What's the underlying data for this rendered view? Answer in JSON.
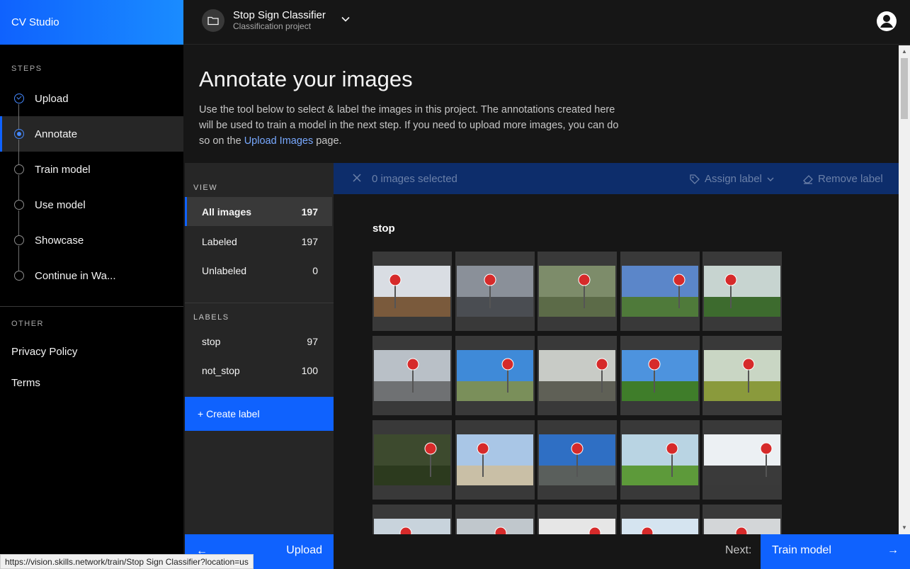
{
  "app": {
    "name": "CV Studio"
  },
  "sidebar": {
    "steps_label": "STEPS",
    "steps": [
      {
        "label": "Upload",
        "state": "done"
      },
      {
        "label": "Annotate",
        "state": "active"
      },
      {
        "label": "Train model",
        "state": "todo"
      },
      {
        "label": "Use model",
        "state": "todo"
      },
      {
        "label": "Showcase",
        "state": "todo"
      },
      {
        "label": "Continue in Wa...",
        "state": "todo"
      }
    ],
    "other_label": "OTHER",
    "other_links": [
      "Privacy Policy",
      "Terms"
    ]
  },
  "header": {
    "project_title": "Stop Sign Classifier",
    "project_subtitle": "Classification project",
    "icons": {
      "project": "folder-icon",
      "toggle": "chevron-down-icon",
      "account": "user-avatar-icon"
    }
  },
  "main": {
    "title": "Annotate your images",
    "description_before": "Use the tool below to select & label the images in this project. The annotations created here will be used to train a model in the next step. If you need to upload more images, you can do so on the ",
    "description_link": "Upload Images",
    "description_after": " page."
  },
  "filters": {
    "view_label": "VIEW",
    "views": [
      {
        "label": "All images",
        "count": "197",
        "active": true
      },
      {
        "label": "Labeled",
        "count": "197",
        "active": false
      },
      {
        "label": "Unlabeled",
        "count": "0",
        "active": false
      }
    ],
    "labels_label": "LABELS",
    "labels": [
      {
        "label": "stop",
        "count": "97"
      },
      {
        "label": "not_stop",
        "count": "100"
      }
    ],
    "create_label": "+ Create label"
  },
  "action_bar": {
    "selected_text": "0 images selected",
    "assign_label": "Assign label",
    "remove_label": "Remove label"
  },
  "gallery": {
    "group_title": "stop",
    "images": [
      {
        "sky": "#d9dde3",
        "ground": "#7a5a3c"
      },
      {
        "sky": "#8a9099",
        "ground": "#4a4d52"
      },
      {
        "sky": "#7d8c6a",
        "ground": "#5c6b48"
      },
      {
        "sky": "#5b86c9",
        "ground": "#4f7a3a"
      },
      {
        "sky": "#c7d4d0",
        "ground": "#3d6b2e"
      },
      {
        "sky": "#b9c0c7",
        "ground": "#6f7173"
      },
      {
        "sky": "#3f8ad8",
        "ground": "#7a8f5a"
      },
      {
        "sky": "#c8cbc6",
        "ground": "#5f6056"
      },
      {
        "sky": "#4d93de",
        "ground": "#3f7d2a"
      },
      {
        "sky": "#c9d6c4",
        "ground": "#8a9a3c"
      },
      {
        "sky": "#3d4a2e",
        "ground": "#2c3a1e"
      },
      {
        "sky": "#a9c6e6",
        "ground": "#c9bfa6"
      },
      {
        "sky": "#2f6fc4",
        "ground": "#5a5f5c"
      },
      {
        "sky": "#b9d4e3",
        "ground": "#5d9a3a"
      },
      {
        "sky": "#ecf0f3",
        "ground": "#3a3a3a"
      },
      {
        "sky": "#c8d3dc",
        "ground": "#5e6b45"
      },
      {
        "sky": "#c0c7cc",
        "ground": "#6a5a4a"
      },
      {
        "sky": "#e6e6e6",
        "ground": "#2f2f2f"
      },
      {
        "sky": "#d5e4f0",
        "ground": "#4c7a3a"
      },
      {
        "sky": "#d3d6d8",
        "ground": "#8a8a8a"
      }
    ]
  },
  "footer": {
    "back_label": "Upload",
    "next_prefix": "Next:",
    "next_label": "Train model"
  },
  "statusbar": {
    "url": "https://vision.skills.network/train/Stop Sign Classifier?location=us"
  },
  "colors": {
    "accent": "#0f62fe",
    "background": "#161616",
    "sidebar": "#000000",
    "action_bar": "#0d2d6b"
  }
}
